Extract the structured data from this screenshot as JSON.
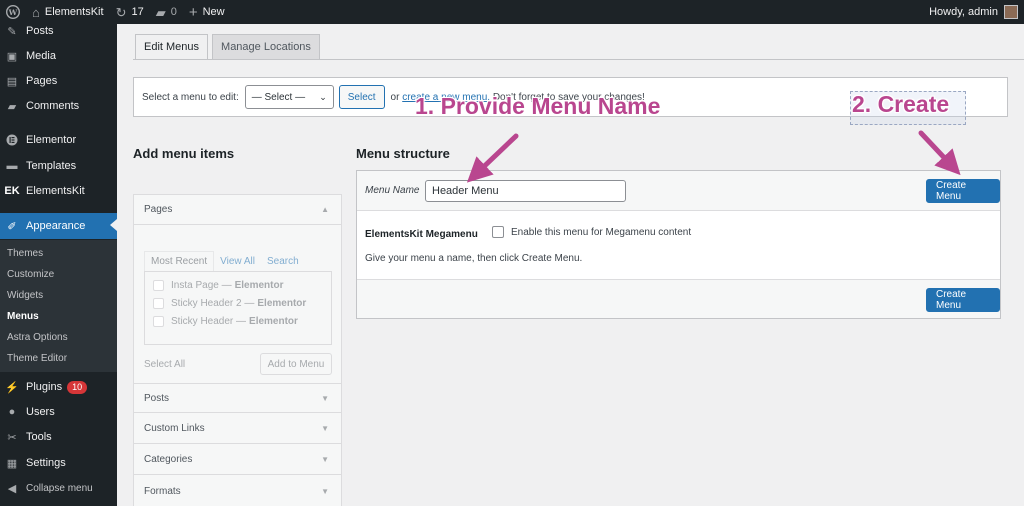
{
  "admin_bar": {
    "site_name": "ElementsKit",
    "updates_count": "17",
    "comments_count": "0",
    "new_label": "New",
    "howdy": "Howdy, admin"
  },
  "sidebar": {
    "items": [
      {
        "label": "Posts",
        "icon": "pin-icon"
      },
      {
        "label": "Media",
        "icon": "media-icon"
      },
      {
        "label": "Pages",
        "icon": "pages-icon"
      },
      {
        "label": "Comments",
        "icon": "comment-icon"
      },
      {
        "label": "Elementor",
        "icon": "elementor-icon"
      },
      {
        "label": "Templates",
        "icon": "folder-icon"
      },
      {
        "label": "ElementsKit",
        "icon": "elementskit-icon"
      },
      {
        "label": "Appearance",
        "icon": "brush-icon"
      },
      {
        "label": "Plugins",
        "icon": "plugin-icon",
        "badge": "10"
      },
      {
        "label": "Users",
        "icon": "user-icon"
      },
      {
        "label": "Tools",
        "icon": "wrench-icon"
      },
      {
        "label": "Settings",
        "icon": "settings-icon"
      },
      {
        "label": "Collapse menu",
        "icon": "collapse-icon"
      }
    ],
    "submenu": [
      "Themes",
      "Customize",
      "Widgets",
      "Menus",
      "Astra Options",
      "Theme Editor"
    ]
  },
  "tabs": {
    "edit_menus": "Edit Menus",
    "manage_locations": "Manage Locations"
  },
  "manage": {
    "label": "Select a menu to edit:",
    "select_value": "— Select —",
    "select_button": "Select",
    "or_text": "or",
    "create_link": "create a new menu.",
    "reminder": "Don't forget to save your changes!"
  },
  "add_items": {
    "title": "Add menu items",
    "pages_label": "Pages",
    "inner_tabs": [
      "Most Recent",
      "View All",
      "Search"
    ],
    "pages": [
      {
        "title": "Insta Page",
        "suffix": "Elementor"
      },
      {
        "title": "Sticky Header 2",
        "suffix": "Elementor"
      },
      {
        "title": "Sticky Header",
        "suffix": "Elementor"
      }
    ],
    "select_all": "Select All",
    "add_to_menu": "Add to Menu",
    "sections": [
      "Posts",
      "Custom Links",
      "Categories",
      "Formats"
    ]
  },
  "menu_structure": {
    "title": "Menu structure",
    "name_label": "Menu Name",
    "name_value": "Header Menu",
    "create_button": "Create Menu",
    "megamenu_title": "ElementsKit Megamenu",
    "megamenu_checkbox": "Enable this menu for Megamenu content",
    "instructions": "Give your menu a name, then click Create Menu.",
    "create_button_bottom": "Create Menu"
  },
  "annotations": {
    "step1": "1. Provide Menu Name",
    "step2": "2. Create",
    "color": "#b9468f"
  },
  "colors": {
    "sidebar_bg": "#1d2327",
    "accent": "#2271b1",
    "badge": "#d63638"
  }
}
